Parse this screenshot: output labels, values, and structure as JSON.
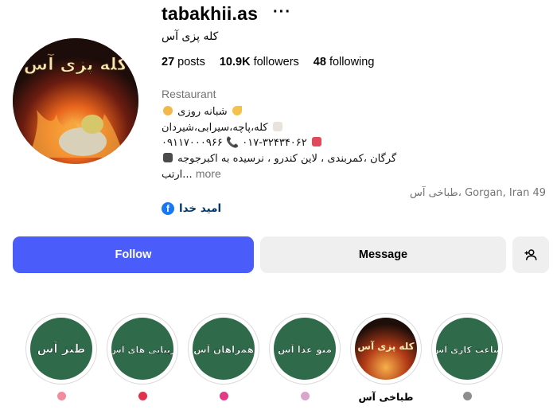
{
  "profile": {
    "username": "tabakhii.as",
    "more_glyph": "···",
    "full_name": "کله پزی آس",
    "category": "Restaurant",
    "stats": {
      "posts_count": "27",
      "posts_label": "posts",
      "followers_count": "10.9K",
      "followers_label": "followers",
      "following_count": "48",
      "following_label": "following"
    },
    "bio": {
      "line1": "شبانه روزی",
      "line2": "کله،پاچه،سیرابی،شیردان",
      "line3": "۰۹۱۱۷۰۰۰۹۶۶ 📞 ۰۱۷-۳۲۴۳۴۰۶۲",
      "line4": "گرگان ،کمربندی ، لاین کندرو ، نرسیده به اکبرجوجه",
      "line5": "ارتب...",
      "more_label": "more"
    },
    "location": "طباخی آس، Gorgan, Iran 49",
    "link": {
      "icon": "facebook-icon",
      "text": "امید خدا"
    },
    "avatar": {
      "icon": "restaurant-logo",
      "text": "کله پزی آس"
    }
  },
  "actions": {
    "follow_label": "Follow",
    "message_label": "Message",
    "suggest_icon": "add-person-icon"
  },
  "highlights": [
    {
      "title_text": "طنز آس",
      "label": "",
      "emoji_color": "#f28b9b"
    },
    {
      "title_text": "زیبایی های آس",
      "label": "",
      "emoji_color": "#e0324a"
    },
    {
      "title_text": "همراهان آس",
      "label": "",
      "emoji_color": "#e23b86"
    },
    {
      "title_text": "منو غذا آس",
      "label": "",
      "emoji_color": "#d9a6c9"
    },
    {
      "title_text": "کله پزی آس",
      "label": "طباخی آس",
      "emoji_color": ""
    },
    {
      "title_text": "ساعت کاری آس",
      "label": "",
      "emoji_color": "#8e8e8e"
    }
  ],
  "colors": {
    "accent": "#4a5dfb",
    "secondary_button": "#efefef",
    "muted_text": "#737373",
    "link_text": "#00376b",
    "highlight_green": "#2f6b4a"
  }
}
